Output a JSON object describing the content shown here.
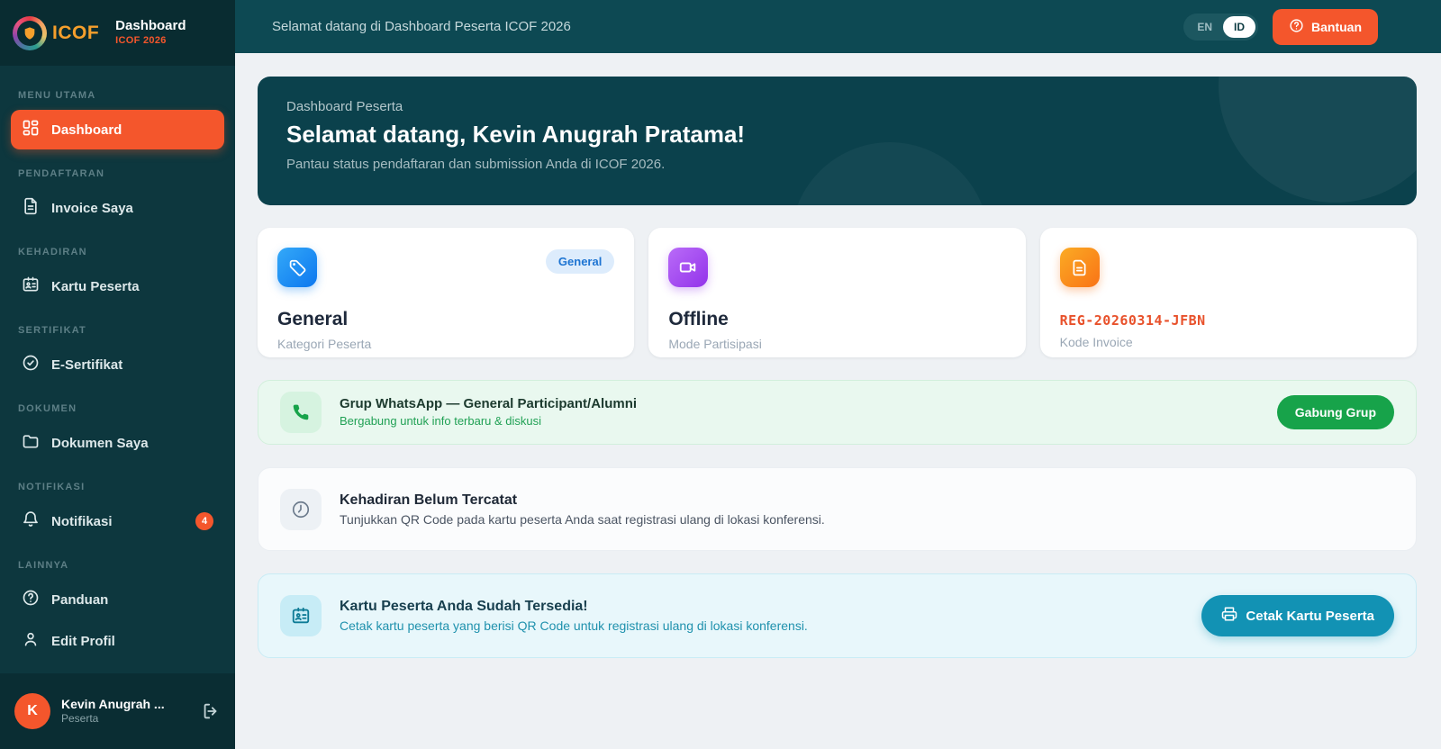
{
  "brand": {
    "name": "ICOF",
    "app_title": "Dashboard",
    "app_subtitle": "ICOF 2026"
  },
  "topbar": {
    "title": "Selamat datang di Dashboard Peserta ICOF 2026",
    "lang_en": "EN",
    "lang_id": "ID",
    "help_label": "Bantuan"
  },
  "sidebar": {
    "sections": [
      {
        "label": "MENU UTAMA",
        "items": [
          {
            "label": "Dashboard",
            "icon": "dashboard-icon",
            "active": true
          }
        ]
      },
      {
        "label": "PENDAFTARAN",
        "items": [
          {
            "label": "Invoice Saya",
            "icon": "invoice-icon"
          }
        ]
      },
      {
        "label": "KEHADIRAN",
        "items": [
          {
            "label": "Kartu Peserta",
            "icon": "id-card-icon"
          }
        ]
      },
      {
        "label": "SERTIFIKAT",
        "items": [
          {
            "label": "E-Sertifikat",
            "icon": "certificate-icon"
          }
        ]
      },
      {
        "label": "DOKUMEN",
        "items": [
          {
            "label": "Dokumen Saya",
            "icon": "folder-icon"
          }
        ]
      },
      {
        "label": "NOTIFIKASI",
        "items": [
          {
            "label": "Notifikasi",
            "icon": "bell-icon",
            "badge": "4"
          }
        ]
      },
      {
        "label": "LAINNYA",
        "items": [
          {
            "label": "Panduan",
            "icon": "help-icon"
          },
          {
            "label": "Edit Profil",
            "icon": "user-icon"
          }
        ]
      }
    ],
    "user": {
      "initial": "K",
      "name": "Kevin Anugrah ...",
      "role": "Peserta"
    }
  },
  "welcome": {
    "eyebrow": "Dashboard Peserta",
    "title": "Selamat datang, Kevin Anugrah Pratama!",
    "subtitle": "Pantau status pendaftaran dan submission Anda di ICOF 2026."
  },
  "cards": [
    {
      "title": "General",
      "subtitle": "Kategori Peserta",
      "badge": "General",
      "icon": "tag-icon"
    },
    {
      "title": "Offline",
      "subtitle": "Mode Partisipasi",
      "icon": "video-icon"
    },
    {
      "title": "REG-20260314-JFBN",
      "subtitle": "Kode Invoice",
      "icon": "file-icon"
    }
  ],
  "banners": {
    "whatsapp": {
      "title": "Grup WhatsApp — General Participant/Alumni",
      "subtitle": "Bergabung untuk info terbaru & diskusi",
      "button": "Gabung Grup"
    },
    "attendance": {
      "title": "Kehadiran Belum Tercatat",
      "subtitle": "Tunjukkan QR Code pada kartu peserta Anda saat registrasi ulang di lokasi konferensi."
    },
    "card_ready": {
      "title": "Kartu Peserta Anda Sudah Tersedia!",
      "subtitle": "Cetak kartu peserta yang berisi QR Code untuk registrasi ulang di lokasi konferensi.",
      "button": "Cetak Kartu Peserta"
    }
  },
  "colors": {
    "accent_orange": "#f4562c",
    "sidebar_teal": "#0d373e",
    "topbar_teal": "#0d4953",
    "banner_teal": "#0b414c",
    "green": "#17a34a",
    "cyan": "#1292b4",
    "invoice_code": "#e8512b"
  }
}
